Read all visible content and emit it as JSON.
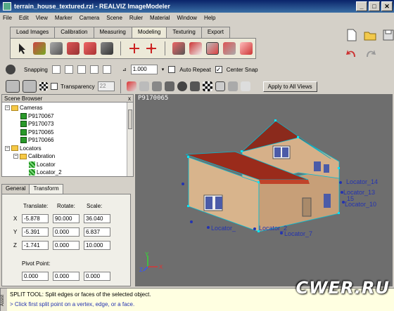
{
  "window": {
    "title": "terrain_house_textured.rzi - REALVIZ ImageModeler",
    "minimize": "_",
    "maximize": "□",
    "close": "✕"
  },
  "menu": [
    "File",
    "Edit",
    "View",
    "Marker",
    "Camera",
    "Scene",
    "Ruler",
    "Material",
    "Window",
    "Help"
  ],
  "tabs": [
    "Load Images",
    "Calibration",
    "Measuring",
    "Modeling",
    "Texturing",
    "Export"
  ],
  "active_tab": "Modeling",
  "snapping": {
    "label": "Snapping",
    "value": "1.000",
    "auto_repeat": "Auto Repeat",
    "auto_repeat_checked": false,
    "center_snap": "Center Snap",
    "center_snap_checked": true
  },
  "render": {
    "transparency_label": "Transparency",
    "transparency_value": "22",
    "apply_all": "Apply to All Views"
  },
  "scene_browser": {
    "title": "Scene Browser",
    "close": "x",
    "cameras_label": "Cameras",
    "cameras": [
      "P9170067",
      "P9170073",
      "P9170065",
      "P9170066"
    ],
    "locators_label": "Locators",
    "calibration_label": "Calibration",
    "locators": [
      "Locator",
      "Locator_2"
    ]
  },
  "panel": {
    "tabs": [
      "General",
      "Transform"
    ],
    "active": "Transform",
    "headers": {
      "translate": "Translate:",
      "rotate": "Rotate:",
      "scale": "Scale:"
    },
    "axes": [
      "X",
      "Y",
      "Z"
    ],
    "rows": [
      {
        "t": "-5.878",
        "r": "90.000",
        "s": "36.040"
      },
      {
        "t": "-5.391",
        "r": "0.000",
        "s": "6.837"
      },
      {
        "t": "-1.741",
        "r": "0.000",
        "s": "10.000"
      }
    ],
    "pivot_label": "Pivot Point:",
    "pivot": [
      "0.000",
      "0.000",
      "0.000"
    ]
  },
  "viewport": {
    "camera": "P9170065",
    "locator_labels": [
      "Locator_14",
      "Locator_13",
      "_15",
      "Locator_10",
      "Locator_",
      "Locator_2",
      "Locator_7"
    ],
    "axes": {
      "x": "X",
      "y": "Y",
      "z": "Z"
    }
  },
  "status": {
    "assist": "Assist",
    "line1": "SPLIT TOOL: Split edges or faces of the selected object.",
    "line2": "> Click first split point on a vertex, edge, or a face."
  },
  "watermark": "CWER.RU",
  "colors": {
    "titlebar": "#0a246a",
    "viewport": "#6e6e6e",
    "locator_text": "#2433b0",
    "status_bg": "#ffffe1"
  }
}
